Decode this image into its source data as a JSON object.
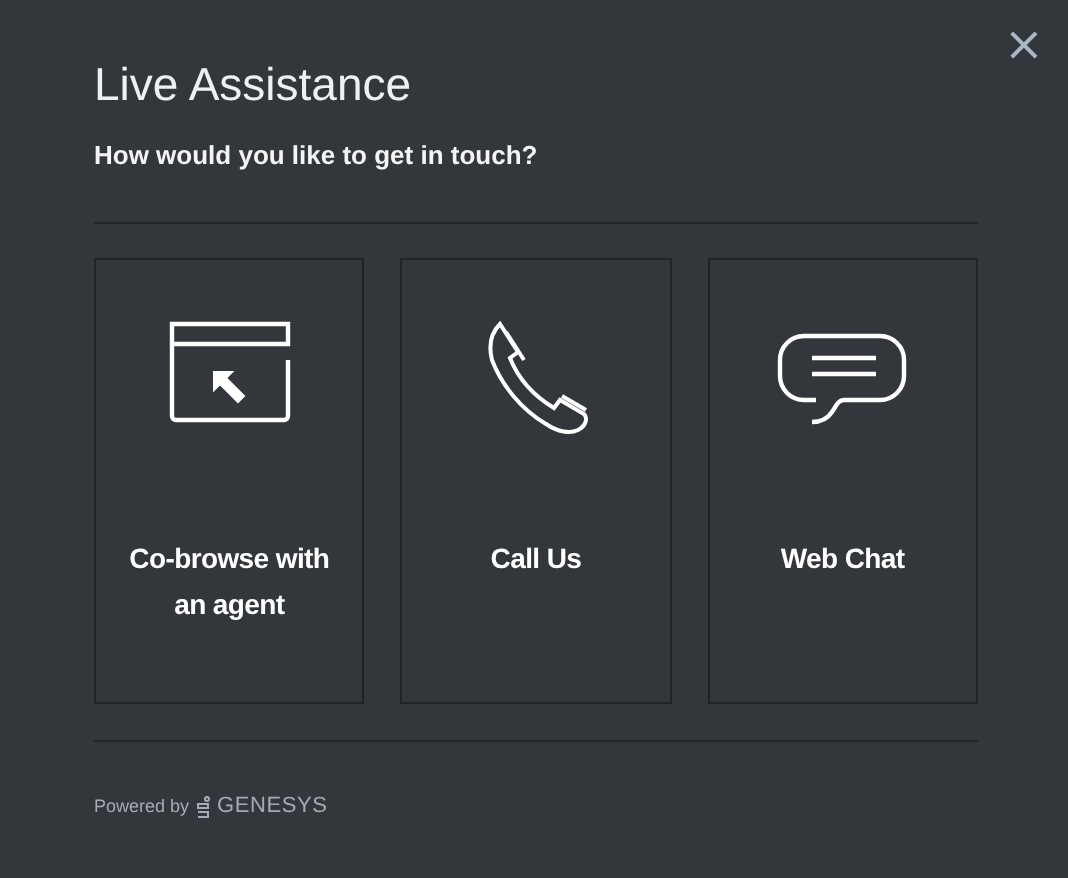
{
  "dialog": {
    "title": "Live Assistance",
    "subtitle": "How would you like to get in touch?",
    "close": "×"
  },
  "options": [
    {
      "kind": "cobrowse",
      "label": "Co-browse with an agent"
    },
    {
      "kind": "call",
      "label": "Call Us"
    },
    {
      "kind": "chat",
      "label": "Web Chat"
    }
  ],
  "footer": {
    "powered_by": "Powered by",
    "brand": "GENESYS"
  }
}
